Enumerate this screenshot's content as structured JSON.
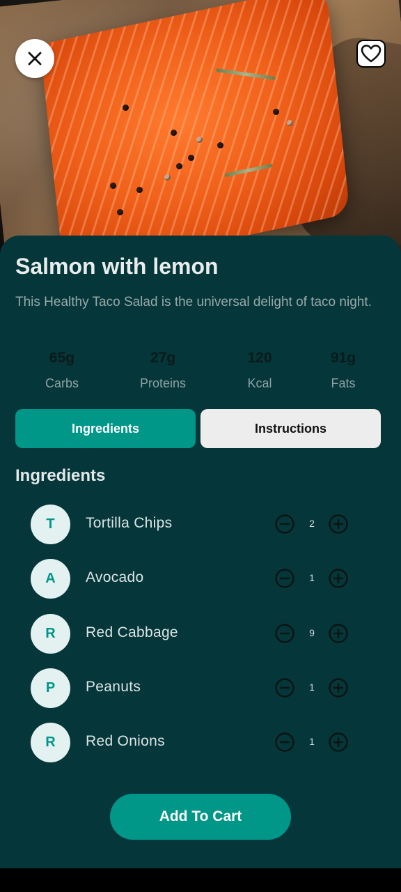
{
  "recipe": {
    "title": "Salmon with lemon",
    "description": "This Healthy Taco Salad is the universal delight of taco night."
  },
  "nutrition": [
    {
      "value": "65g",
      "label": "Carbs"
    },
    {
      "value": "27g",
      "label": "Proteins"
    },
    {
      "value": "120",
      "label": "Kcal"
    },
    {
      "value": "91g",
      "label": "Fats"
    }
  ],
  "tabs": {
    "ingredients_label": "Ingredients",
    "instructions_label": "Instructions",
    "active": "ingredients"
  },
  "ingredients_section": {
    "title": "Ingredients",
    "items": [
      {
        "initial": "T",
        "name": "Tortilla Chips",
        "qty": "2"
      },
      {
        "initial": "A",
        "name": "Avocado",
        "qty": "1"
      },
      {
        "initial": "R",
        "name": "Red Cabbage",
        "qty": "9"
      },
      {
        "initial": "P",
        "name": "Peanuts",
        "qty": "1"
      },
      {
        "initial": "R",
        "name": "Red Onions",
        "qty": "1"
      }
    ]
  },
  "actions": {
    "add_to_cart_label": "Add To Cart"
  },
  "icons": {
    "close": "close-icon",
    "favorite": "heart-outline-icon",
    "decrement": "minus-circle-icon",
    "increment": "plus-circle-icon"
  },
  "colors": {
    "sheet_background": "#04363a",
    "accent": "#009688",
    "tab_inactive": "#ededed",
    "avatar_background": "#e3f1f1"
  }
}
